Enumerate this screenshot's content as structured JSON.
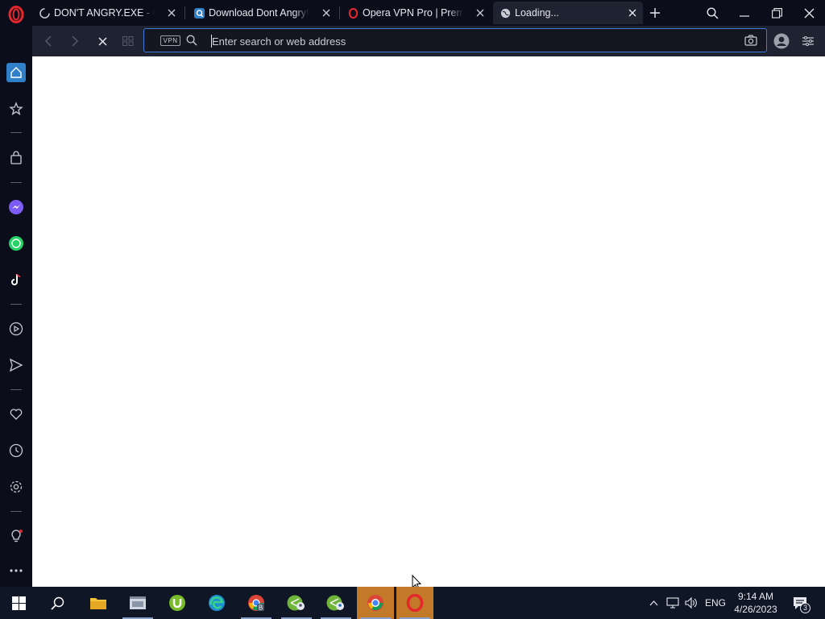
{
  "browser": {
    "tabs": [
      {
        "title": "DON'T ANGRY.EXE - Goo",
        "favicon": "loading-spinner-icon"
      },
      {
        "title": "Download Dont Angry! by",
        "favicon": "search-favicon-icon"
      },
      {
        "title": "Opera VPN Pro | Premium",
        "favicon": "opera-favicon-icon"
      },
      {
        "title": "Loading...",
        "favicon": "globe-icon",
        "active": true
      }
    ],
    "address_bar": {
      "vpn_label": "VPN",
      "placeholder": "Enter search or web address",
      "value": ""
    },
    "accent_color": "#3d7bd6"
  },
  "sidebar": {
    "items": [
      "home-icon",
      "star-icon",
      "bag-icon",
      "messenger-icon",
      "whatsapp-icon",
      "tiktok-icon",
      "player-icon",
      "send-icon",
      "heart-icon",
      "history-icon",
      "settings-icon",
      "lightbulb-icon",
      "more-icon"
    ]
  },
  "taskbar": {
    "apps": [
      "file-explorer",
      "app-window",
      "utorrent",
      "edge",
      "chrome-b",
      "account-1",
      "account-2",
      "chrome",
      "opera"
    ],
    "language": "ENG",
    "time": "9:14 AM",
    "date": "4/26/2023",
    "notification_count": "3"
  }
}
